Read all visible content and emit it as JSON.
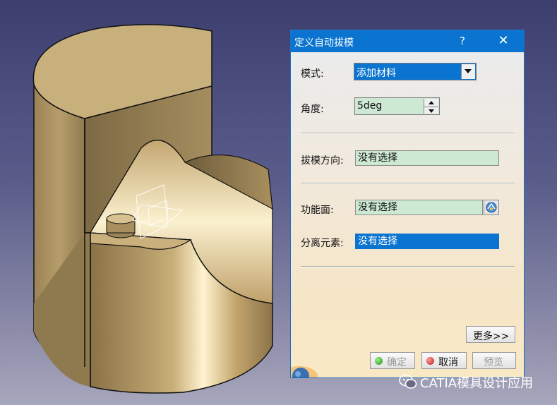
{
  "dialog": {
    "title": "定义自动拔模",
    "help_label": "?",
    "close_label": "✕",
    "mode": {
      "label": "模式:",
      "value": "添加材料"
    },
    "angle": {
      "label": "角度:",
      "value": "5deg"
    },
    "pull_direction": {
      "label": "拔模方向:",
      "value": "没有选择"
    },
    "functional_face": {
      "label": "功能面:",
      "value": "没有选择"
    },
    "parting_element": {
      "label": "分离元素:",
      "value": "没有选择"
    },
    "buttons": {
      "more": "更多>>",
      "ok": "确定",
      "cancel": "取消",
      "preview": "预览"
    }
  },
  "watermark": {
    "text": "CATIA模具设计应用"
  },
  "colors": {
    "titlebar": "#0a74d0",
    "field_green": "#cde8d3",
    "selection_blue": "#0a74d0",
    "part_face": "#c8b07c"
  },
  "icons": [
    "help-icon",
    "close-icon",
    "dropdown-arrow-icon",
    "spin-up-icon",
    "spin-down-icon",
    "face-pick-icon",
    "ok-dot-icon",
    "cancel-dot-icon",
    "wechat-icon"
  ]
}
